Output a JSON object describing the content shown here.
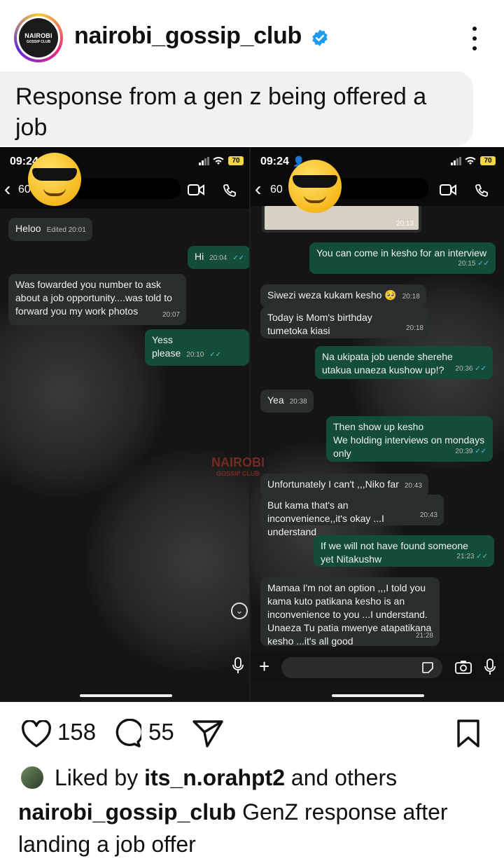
{
  "post": {
    "username": "nairobi_gossip_club",
    "avatar_text_1": "NAIROBI",
    "avatar_text_2": "GOSSIP CLUB",
    "caption_title": "Response from a gen z being offered a job",
    "likes": "158",
    "comments": "55",
    "liked_by_prefix": "Liked by",
    "liked_by_user": "its_n.orahpt2",
    "liked_by_suffix": "and others",
    "description": "GenZ response after landing a job offer",
    "watermark_1": "NAIROBI",
    "watermark_2": "GOSSIP CLUB"
  },
  "left_chat": {
    "time": "09:24",
    "battery": "70",
    "contact": "60",
    "messages": [
      {
        "dir": "in",
        "text": "Heloo",
        "time": "Edited 20:01"
      },
      {
        "dir": "out",
        "text": "Hi",
        "time": "20:04"
      },
      {
        "dir": "in",
        "text": "Was fowarded you number to ask about a job opportunity....was told to forward you my work photos",
        "time": "20:07"
      },
      {
        "dir": "out",
        "text": "Yess please",
        "time": "20:10"
      }
    ]
  },
  "right_chat": {
    "time": "09:24",
    "battery": "70",
    "contact": "60",
    "image_time": "20:13",
    "messages": [
      {
        "dir": "out",
        "text": "You can come in kesho for an interview",
        "time": "20:15"
      },
      {
        "dir": "in",
        "text": "Siwezi weza kukam kesho 🥺",
        "time": "20:18"
      },
      {
        "dir": "in",
        "text": "Today is Mom's birthday tumetoka kiasi",
        "time": "20:18"
      },
      {
        "dir": "out",
        "text": "Na ukipata job uende sherehe utakua unaeza kushow up!?",
        "time": "20:36"
      },
      {
        "dir": "in",
        "text": "Yea",
        "time": "20:38"
      },
      {
        "dir": "out",
        "text": "Then show up kesho\nWe holding interviews on mondays only",
        "time": "20:39"
      },
      {
        "dir": "in",
        "text": "Unfortunately I can't ,,,Niko far",
        "time": "20:43"
      },
      {
        "dir": "in",
        "text": "But kama that's an inconvenience,,it's okay ...I understand",
        "time": "20:43"
      },
      {
        "dir": "out",
        "text": "If we will not have found someone yet Nitakushw",
        "time": "21:23"
      },
      {
        "dir": "in",
        "text": "Mamaa I'm not an option ,,,I told you kama kuto patikana kesho is an inconvenience to you ...I understand. Unaeza Tu patia mwenye atapatikana kesho ...it's all good",
        "time": "21:28"
      }
    ]
  }
}
